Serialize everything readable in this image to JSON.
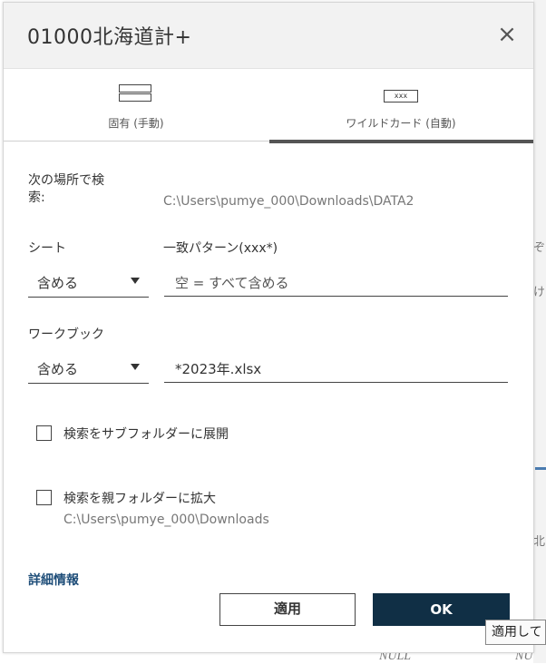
{
  "dialog": {
    "title": "01000北海道計+",
    "close_glyph": "×"
  },
  "tabs": [
    {
      "label": "固有 (手動)",
      "icon": "table-rows-icon",
      "active": false
    },
    {
      "label": "ワイルドカード (自動)",
      "icon": "wildcard-icon",
      "icon_text": "xxx",
      "active": true
    }
  ],
  "search": {
    "location_label": "次の場所で検\n索:",
    "location_path": "C:\\Users\\pumye_000\\Downloads\\DATA2"
  },
  "sheet": {
    "label": "シート",
    "mode": "含める",
    "pattern_label": "一致パターン(xxx*)",
    "pattern_placeholder": "空 = すべて含める"
  },
  "workbook": {
    "label": "ワークブック",
    "mode": "含める",
    "pattern_value": "*2023年.xlsx"
  },
  "options": {
    "subfolders_label": "検索をサブフォルダーに展開",
    "subfolders_checked": false,
    "parent_label": "検索を親フォルダーに拡大",
    "parent_checked": false,
    "parent_path": "C:\\Users\\pumye_000\\Downloads"
  },
  "details_link": "詳細情報",
  "buttons": {
    "apply": "適用",
    "ok": "OK"
  },
  "tooltip": "適用して",
  "background": {
    "null_left": "NULL",
    "null_right": "NU",
    "snippet_a": "ぞ",
    "snippet_b": "け",
    "snippet_c": "北"
  },
  "colors": {
    "ok_button": "#102f45",
    "link": "#1f4e79",
    "titlebar": "#f2f2f2"
  }
}
